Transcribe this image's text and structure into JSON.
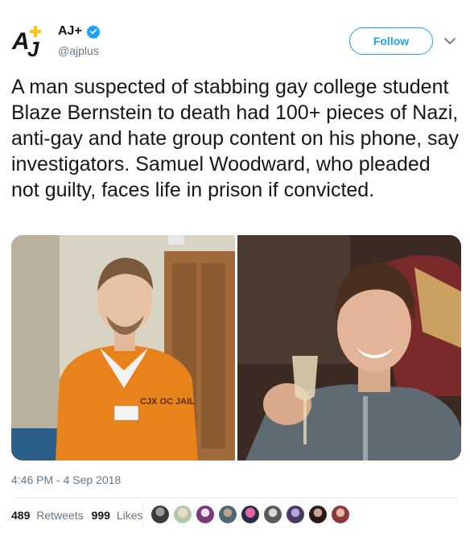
{
  "account": {
    "display_name": "AJ+",
    "handle": "@ajplus",
    "verified": true,
    "logo_icon": "ajplus-logo-icon"
  },
  "actions": {
    "follow_label": "Follow",
    "menu_icon": "chevron-down-icon"
  },
  "tweet": {
    "text": "A man suspected of stabbing gay college student Blaze Bernstein to death had 100+ pieces of Nazi, anti-gay and hate group content on his phone, say investigators. Samuel Woodward, who pleaded not guilty, faces life in prison if convicted.",
    "timestamp": "4:46 PM - 4 Sep 2018"
  },
  "media": {
    "photos": [
      "photo-man-orange-jumpsuit",
      "photo-young-man-holding-glass"
    ],
    "left_photo_overlay_text": "CJX OC JAIL"
  },
  "stats": {
    "retweets_count": "489",
    "retweets_label": "Retweets",
    "likes_count": "999",
    "likes_label": "Likes"
  },
  "likers": {
    "avatar_count_shown": 9
  },
  "colors": {
    "brand_blue": "#1da1f2",
    "text_primary": "#14171a",
    "text_secondary": "#657786",
    "divider": "#e6ecf0"
  }
}
